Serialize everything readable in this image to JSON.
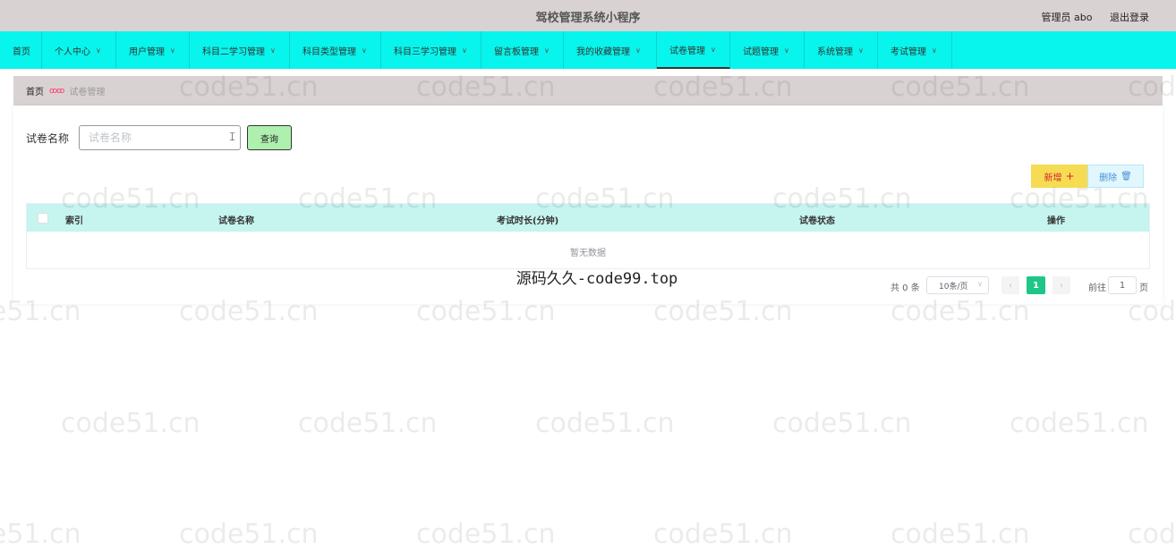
{
  "header": {
    "app_title": "驾校管理系统小程序",
    "user_label": "管理员 abo",
    "logout_label": "退出登录"
  },
  "nav": {
    "items": [
      {
        "label": "首页",
        "has_menu": false
      },
      {
        "label": "个人中心",
        "has_menu": true
      },
      {
        "label": "用户管理",
        "has_menu": true
      },
      {
        "label": "科目二学习管理",
        "has_menu": true
      },
      {
        "label": "科目类型管理",
        "has_menu": true
      },
      {
        "label": "科目三学习管理",
        "has_menu": true
      },
      {
        "label": "留言板管理",
        "has_menu": true
      },
      {
        "label": "我的收藏管理",
        "has_menu": true
      },
      {
        "label": "试卷管理",
        "has_menu": true,
        "active": true
      },
      {
        "label": "试题管理",
        "has_menu": true
      },
      {
        "label": "系统管理",
        "has_menu": true
      },
      {
        "label": "考试管理",
        "has_menu": true
      }
    ]
  },
  "breadcrumb": {
    "home": "首页",
    "separator": "ꝏꝏ",
    "current": "试卷管理"
  },
  "search": {
    "label": "试卷名称",
    "placeholder": "试卷名称",
    "value": "",
    "button": "查询"
  },
  "actions": {
    "add_label": "新增",
    "delete_label": "删除"
  },
  "table": {
    "columns": [
      "索引",
      "试卷名称",
      "考试时长(分钟)",
      "试卷状态",
      "操作"
    ],
    "rows": [],
    "empty_text": "暂无数据"
  },
  "pagination": {
    "total_text": "共 0 条",
    "page_size": "10条/页",
    "current_page": "1",
    "goto_label": "前往",
    "goto_value": "1",
    "page_suffix": "页"
  },
  "watermark": {
    "center_text": "源码久久-code99.top",
    "repeat_text": "code51.cn"
  },
  "colors": {
    "topbar": "#d9d2d3",
    "navbar": "#07f5ec",
    "table_header": "#c6f4ee",
    "query_button": "#aef0ae",
    "add_button": "#f5dc52",
    "delete_button": "#e1f7fd",
    "active_page": "#1ec787"
  }
}
